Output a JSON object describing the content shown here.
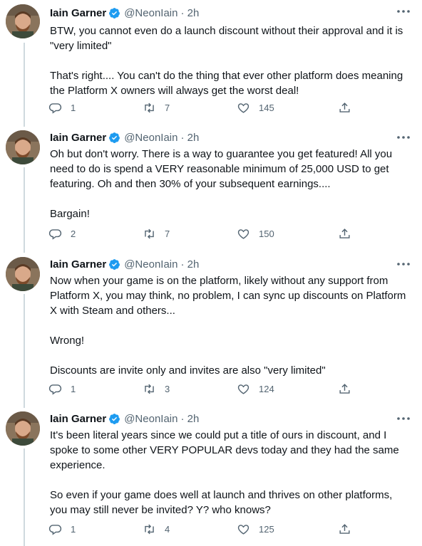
{
  "tweets": [
    {
      "name": "Iain Garner",
      "handle": "@NeonIain",
      "time": "· 2h",
      "text": "BTW, you cannot even do a launch discount without their approval and it is \"very limited\"\n\nThat's right.... You can't do the thing that ever other platform does meaning the Platform X owners will always get the worst deal!",
      "replies": "1",
      "retweets": "7",
      "likes": "145"
    },
    {
      "name": "Iain Garner",
      "handle": "@NeonIain",
      "time": "· 2h",
      "text": "Oh but don't worry. There is a way to guarantee you get featured! All you need to do is spend a VERY reasonable minimum of 25,000 USD to get featuring. Oh and then 30% of your subsequent earnings....\n\nBargain!",
      "replies": "2",
      "retweets": "7",
      "likes": "150"
    },
    {
      "name": "Iain Garner",
      "handle": "@NeonIain",
      "time": "· 2h",
      "text": "Now when your game is on the platform, likely without any support from Platform X, you may think, no problem, I can sync up discounts on Platform X with Steam and others...\n\nWrong!\n\nDiscounts are invite only and invites are also \"very limited\"",
      "replies": "1",
      "retweets": "3",
      "likes": "124"
    },
    {
      "name": "Iain Garner",
      "handle": "@NeonIain",
      "time": "· 2h",
      "text": "It's been literal years since we could put a title of ours in discount, and I spoke to some other VERY POPULAR devs today and they had the same experience.\n\nSo even if your game does well at launch and thrives on other platforms, you may still never be invited? Y? who knows?",
      "replies": "1",
      "retweets": "4",
      "likes": "125"
    }
  ],
  "icons": {
    "verified": "verified-badge-icon",
    "more": "more-options-icon",
    "reply": "reply-icon",
    "retweet": "retweet-icon",
    "like": "like-icon",
    "share": "share-icon"
  },
  "colors": {
    "accent": "#1d9bf0",
    "muted": "#536471",
    "thread_line": "#cfd9de"
  }
}
